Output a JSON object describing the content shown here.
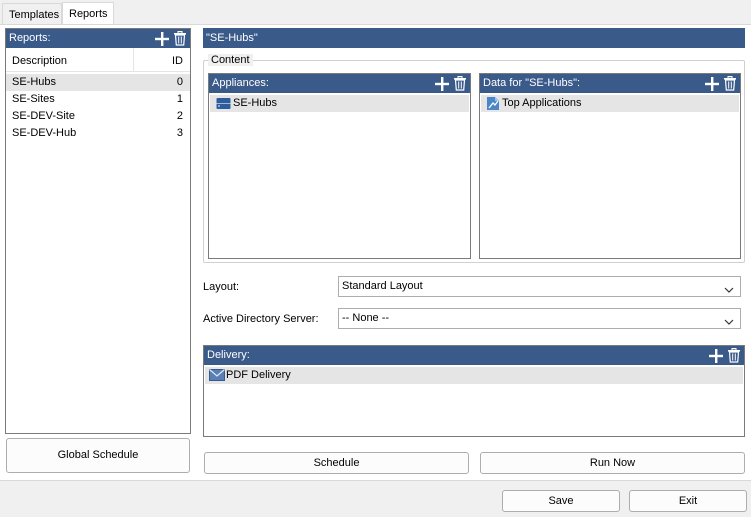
{
  "tabs": [
    {
      "label": "Templates"
    },
    {
      "label": "Reports"
    }
  ],
  "reports_panel": {
    "title": "Reports:",
    "columns": {
      "description": "Description",
      "id": "ID"
    },
    "rows": [
      {
        "description": "SE-Hubs",
        "id": "0"
      },
      {
        "description": "SE-Sites",
        "id": "1"
      },
      {
        "description": "SE-DEV-Site",
        "id": "2"
      },
      {
        "description": "SE-DEV-Hub",
        "id": "3"
      }
    ],
    "global_schedule_label": "Global Schedule"
  },
  "detail": {
    "title": "\"SE-Hubs\"",
    "content_group_label": "Content",
    "appliances": {
      "title": "Appliances:",
      "items": [
        {
          "label": "SE-Hubs",
          "icon": "appliance-icon"
        }
      ]
    },
    "data_for": {
      "title": "Data for \"SE-Hubs\":",
      "items": [
        {
          "label": "Top Applications",
          "icon": "report-chart-icon"
        }
      ]
    },
    "layout": {
      "label": "Layout:",
      "value": "Standard Layout"
    },
    "ad_server": {
      "label": "Active Directory Server:",
      "value": "-- None --"
    },
    "delivery": {
      "title": "Delivery:",
      "items": [
        {
          "label": "PDF Delivery",
          "icon": "envelope-icon"
        }
      ]
    },
    "schedule_label": "Schedule",
    "run_now_label": "Run Now"
  },
  "footer": {
    "save_label": "Save",
    "exit_label": "Exit"
  },
  "colors": {
    "header_bg": "#3a5a8a",
    "selection_bg": "#e5e5e5",
    "window_bg": "#f0f0f0"
  }
}
